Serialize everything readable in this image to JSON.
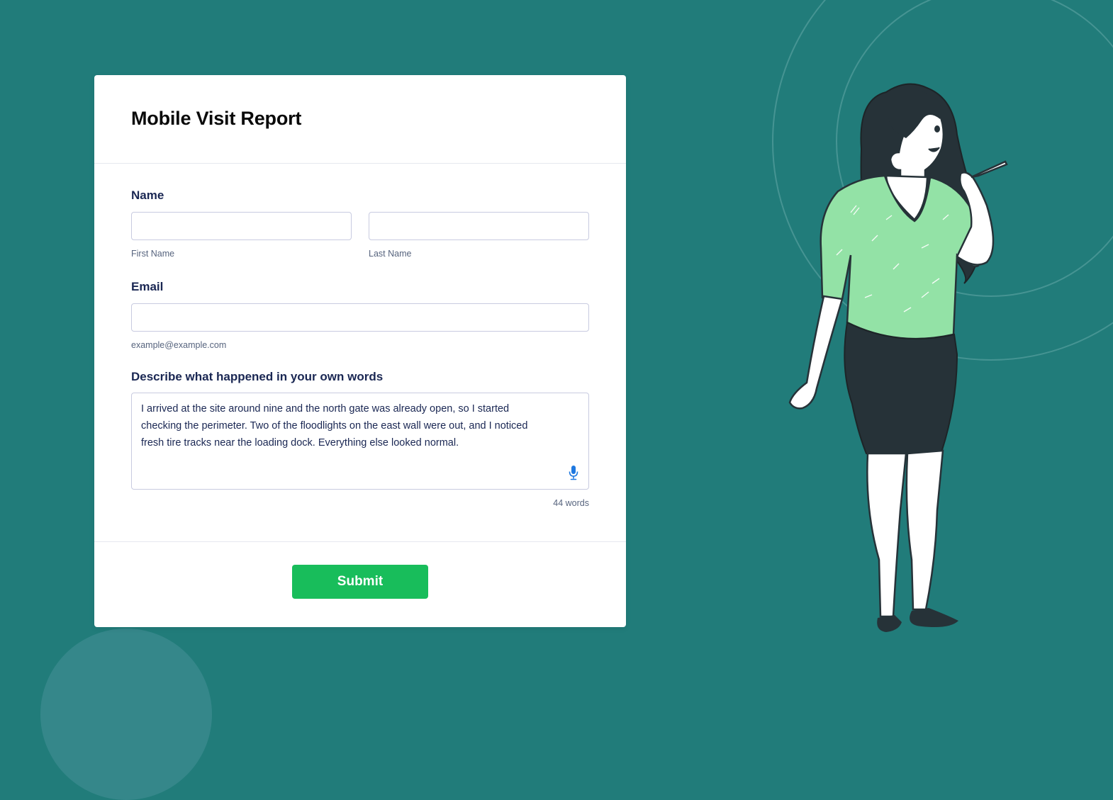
{
  "form": {
    "title": "Mobile Visit Report",
    "name_label": "Name",
    "first_name_value": "",
    "first_name_sublabel": "First Name",
    "last_name_value": "",
    "last_name_sublabel": "Last Name",
    "email_label": "Email",
    "email_value": "",
    "email_sublabel": "example@example.com",
    "description_label": "Describe what happened in your own words",
    "description_value": "I arrived at the site around nine and the north gate was already open, so I started checking the perimeter. Two of the floodlights on the east wall were out, and I noticed fresh tire tracks near the loading dock. Everything else looked normal.",
    "word_count": "44 words",
    "submit_label": "Submit"
  },
  "icons": {
    "mic": "microphone-icon"
  },
  "colors": {
    "background": "#217c7a",
    "accent": "#18bd5b",
    "label_text": "#1a2753",
    "mic_icon": "#1e78e0",
    "shirt": "#93e2a6",
    "skirt": "#263238"
  }
}
